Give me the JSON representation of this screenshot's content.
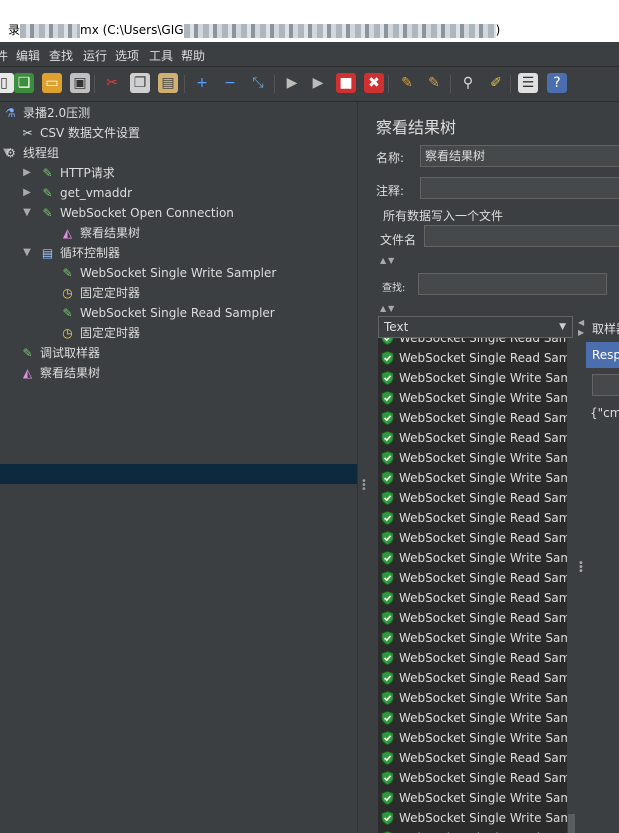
{
  "window": {
    "title_prefix": "录",
    "title_mid": "mx (C:\\Users\\GIG",
    "title_suffix": ")"
  },
  "menu": [
    "件",
    "编辑",
    "查找",
    "运行",
    "选项",
    "工具",
    "帮助"
  ],
  "toolbar": {
    "icons": [
      "new-icon",
      "templates-icon",
      "open-icon",
      "save-icon",
      "cut-icon",
      "copy-icon",
      "paste-icon",
      "expand-icon",
      "collapse-icon",
      "toggle-icon",
      "start-icon",
      "start-no-pause-icon",
      "stop-icon",
      "shutdown-icon",
      "clear-icon",
      "clear-all-icon",
      "search-icon",
      "reset-search-icon",
      "function-helper-icon",
      "help-icon"
    ]
  },
  "tree": [
    {
      "label": "录播2.0压测",
      "icon": "test-plan-icon",
      "indent": 0,
      "arrow": ""
    },
    {
      "label": "CSV 数据文件设置",
      "icon": "csv-config-icon",
      "indent": 1,
      "arrow": ""
    },
    {
      "label": "线程组",
      "icon": "thread-group-icon",
      "indent": 0,
      "arrow": "down"
    },
    {
      "label": "HTTP请求",
      "icon": "sampler-icon",
      "indent": 1,
      "arrow": "right"
    },
    {
      "label": "get_vmaddr",
      "icon": "sampler-icon",
      "indent": 1,
      "arrow": "right"
    },
    {
      "label": "WebSocket Open Connection",
      "icon": "sampler-icon",
      "indent": 1,
      "arrow": "down"
    },
    {
      "label": "察看结果树",
      "icon": "listener-icon",
      "indent": 2,
      "arrow": ""
    },
    {
      "label": "循环控制器",
      "icon": "loop-controller-icon",
      "indent": 1,
      "arrow": "down"
    },
    {
      "label": "WebSocket Single Write Sampler",
      "icon": "sampler-icon",
      "indent": 2,
      "arrow": ""
    },
    {
      "label": "固定定时器",
      "icon": "timer-icon",
      "indent": 2,
      "arrow": ""
    },
    {
      "label": "WebSocket Single Read Sampler",
      "icon": "sampler-icon",
      "indent": 2,
      "arrow": ""
    },
    {
      "label": "固定定时器",
      "icon": "timer-icon",
      "indent": 2,
      "arrow": ""
    },
    {
      "label": "调试取样器",
      "icon": "sampler-icon",
      "indent": 1,
      "arrow": ""
    },
    {
      "label": "察看结果树",
      "icon": "listener-icon",
      "indent": 1,
      "arrow": "",
      "selected": true
    }
  ],
  "panel": {
    "title": "察看结果树",
    "name_label": "名称:",
    "name_value": "察看结果树",
    "comment_label": "注释:",
    "comment_value": "",
    "write_all_label": "所有数据写入一个文件",
    "filename_label": "文件名",
    "filename_value": "",
    "search_label": "查找:",
    "search_value": "",
    "renderer": "Text",
    "sample_result_label": "取样器",
    "response_tab": "Response",
    "response_text": "{\"cmd"
  },
  "results": [
    "WebSocket Single Read Sampler",
    "WebSocket Single Read Sampler",
    "WebSocket Single Write Sampler",
    "WebSocket Single Write Sampler",
    "WebSocket Single Read Sampler",
    "WebSocket Single Read Sampler",
    "WebSocket Single Write Sampler",
    "WebSocket Single Write Sampler",
    "WebSocket Single Read Sampler",
    "WebSocket Single Read Sampler",
    "WebSocket Single Read Sampler",
    "WebSocket Single Write Sampler",
    "WebSocket Single Read Sampler",
    "WebSocket Single Read Sampler",
    "WebSocket Single Read Sampler",
    "WebSocket Single Write Sampler",
    "WebSocket Single Read Sampler",
    "WebSocket Single Read Sampler",
    "WebSocket Single Write Sampler",
    "WebSocket Single Write Sampler",
    "WebSocket Single Write Sampler",
    "WebSocket Single Read Sampler",
    "WebSocket Single Read Sampler",
    "WebSocket Single Write Sampler",
    "WebSocket Single Write Sampler",
    "WebSocket Single Read Sampler"
  ]
}
